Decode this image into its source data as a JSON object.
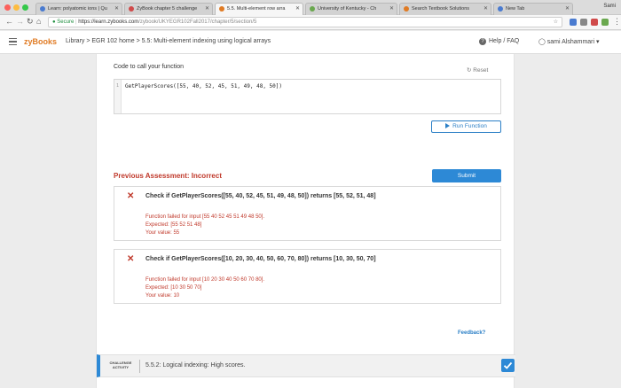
{
  "browser": {
    "tabs": [
      {
        "label": "Learn: polyatomic ions | Qu",
        "icon_color": "#4a7bd0"
      },
      {
        "label": "ZyBook chapter 5 challenge",
        "icon_color": "#d04a4a"
      },
      {
        "label": "5.5. Multi-element row arra",
        "icon_color": "#e07b24"
      },
      {
        "label": "University of Kentucky - Ch",
        "icon_color": "#6aa84f"
      },
      {
        "label": "Search Textbook Solutions",
        "icon_color": "#e07b24"
      },
      {
        "label": "New Tab",
        "icon_color": "#4a7bd0"
      }
    ],
    "active_tab": 2,
    "user_name": "Sami",
    "url_secure": "Secure",
    "url_host": "https://learn.zybooks.com",
    "url_path": "/zybook/UKYEGR102Fall2017/chapter/5/section/5"
  },
  "header": {
    "brand": "zyBooks",
    "breadcrumb": "Library > EGR 102 home > 5.5: Multi-element indexing using logical arrays",
    "help": "Help / FAQ",
    "user": "sami Alshammari"
  },
  "code": {
    "title": "Code to call your function",
    "reset": "Reset",
    "line_number": "1",
    "line": "GetPlayerScores([55, 40, 52, 45, 51, 49, 48, 50])",
    "run": "Run Function"
  },
  "assessment": {
    "title": "Previous Assessment: Incorrect",
    "submit": "Submit",
    "results": [
      {
        "title": "Check if GetPlayerScores([55, 40, 52, 45, 51, 49, 48, 50]) returns [55, 52, 51, 48]",
        "failed": "Function failed for input [55 40 52 45 51 49 48 50].",
        "expected": "Expected: [55 52 51 48]",
        "value": "Your value: 55"
      },
      {
        "title": "Check if GetPlayerScores([10, 20, 30, 40, 50, 60, 70, 80]) returns [10, 30, 50, 70]",
        "failed": "Function failed for input [10 20 30 40 50 60 70 80].",
        "expected": "Expected: [10 30 50 70]",
        "value": "Your value: 10"
      }
    ],
    "feedback": "Feedback?"
  },
  "challenge": {
    "label": "CHALLENGE ACTIVITY",
    "title": "5.5.2: Logical indexing: High scores."
  }
}
